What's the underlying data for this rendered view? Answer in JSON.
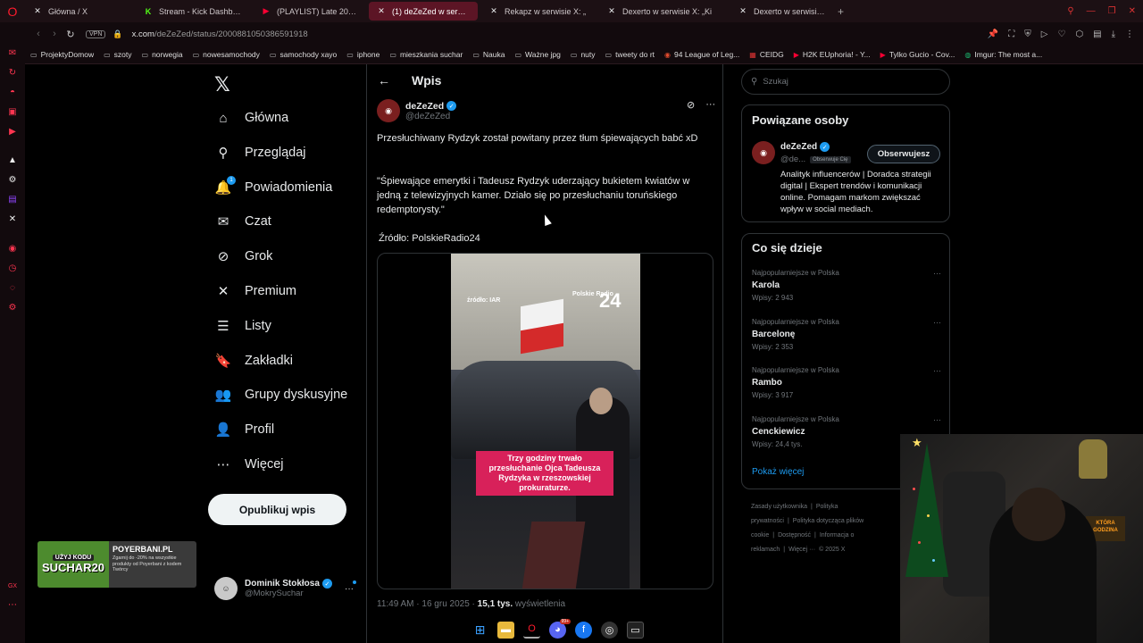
{
  "browser": {
    "tabs": [
      {
        "label": "Główna / X",
        "icon": "x-logo-icon",
        "color": "#e7e9ea",
        "active": false,
        "width": 120
      },
      {
        "label": "Stream - Kick Dashboard",
        "icon": "kick-icon",
        "color": "#53fc18",
        "active": false,
        "width": 128
      },
      {
        "label": "(PLAYLIST) Late 2000's E",
        "icon": "youtube-icon",
        "color": "#ff0033",
        "active": false,
        "width": 125
      },
      {
        "label": "(1) deZeZed w serwisie",
        "icon": "x-logo-icon",
        "color": "#e7e9ea",
        "active": true,
        "width": 122
      },
      {
        "label": "Rekapz w serwisie X: „",
        "icon": "x-logo-icon",
        "color": "#e7e9ea",
        "active": false,
        "width": 128
      },
      {
        "label": "Dexerto w serwisie X: „Ki",
        "icon": "x-logo-icon",
        "color": "#e7e9ea",
        "active": false,
        "width": 143
      },
      {
        "label": "Dexerto w serwisie X: „Va",
        "icon": "x-logo-icon",
        "color": "#e7e9ea",
        "active": false,
        "width": 114
      }
    ],
    "vpn_label": "VPN",
    "url_host": "x.com",
    "url_path": "/deZeZed/status/2000881050386591918",
    "bookmarks": [
      {
        "label": "ProjektyDomow",
        "icon": "folder-icon"
      },
      {
        "label": "szoty",
        "icon": "folder-icon"
      },
      {
        "label": "norwegia",
        "icon": "folder-icon"
      },
      {
        "label": "nowesamochody",
        "icon": "folder-icon"
      },
      {
        "label": "samochody xayo",
        "icon": "folder-icon"
      },
      {
        "label": "iphone",
        "icon": "folder-icon"
      },
      {
        "label": "mieszkania suchar",
        "icon": "folder-icon"
      },
      {
        "label": "Nauka",
        "icon": "folder-icon"
      },
      {
        "label": "Ważne jpg",
        "icon": "folder-icon"
      },
      {
        "label": "nuty",
        "icon": "folder-icon"
      },
      {
        "label": "tweety do rt",
        "icon": "folder-icon"
      },
      {
        "label": "94 League of Leg...",
        "icon": "lol-icon"
      },
      {
        "label": "CEIDG",
        "icon": "ceidg-icon"
      },
      {
        "label": "H2K EUphoria! - Y...",
        "icon": "youtube-icon"
      },
      {
        "label": "Tylko Gucio - Cov...",
        "icon": "youtube-icon"
      },
      {
        "label": "Imgur: The most a...",
        "icon": "imgur-icon"
      }
    ]
  },
  "nav": {
    "items": [
      {
        "label": "Główna",
        "icon": "home-icon",
        "glyph": "⌂"
      },
      {
        "label": "Przeglądaj",
        "icon": "search-icon",
        "glyph": "⚲"
      },
      {
        "label": "Powiadomienia",
        "icon": "bell-icon",
        "glyph": "🔔"
      },
      {
        "label": "Czat",
        "icon": "mail-icon",
        "glyph": "✉"
      },
      {
        "label": "Grok",
        "icon": "grok-icon",
        "glyph": "⊘"
      },
      {
        "label": "Premium",
        "icon": "x-premium-icon",
        "glyph": "✕"
      },
      {
        "label": "Listy",
        "icon": "list-icon",
        "glyph": "☰"
      },
      {
        "label": "Zakładki",
        "icon": "bookmark-icon",
        "glyph": "🔖"
      },
      {
        "label": "Grupy dyskusyjne",
        "icon": "communities-icon",
        "glyph": "👥"
      },
      {
        "label": "Profil",
        "icon": "profile-icon",
        "glyph": "👤"
      },
      {
        "label": "Więcej",
        "icon": "more-circle-icon",
        "glyph": "⋯"
      }
    ],
    "notification_count": "1",
    "post_button": "Opublikuj wpis",
    "account": {
      "name": "Dominik Stokłosa",
      "handle": "@MokrySuchar"
    }
  },
  "ad": {
    "small": "UŻYJ KODU",
    "code": "SUCHAR20",
    "brand": "POYERBANI.PL",
    "text": "Zgarnij do -20% na wszystkie produkty od Poyerbani z kodem Twórcy"
  },
  "post": {
    "header_title": "Wpis",
    "author_name": "deZeZed",
    "author_handle": "@deZeZed",
    "paragraph1": "Przesłuchiwany Rydzyk został powitany przez tłum śpiewających babć xD",
    "paragraph2": "\"Śpiewające emerytki i Tadeusz Rydzyk uderzający bukietem kwiatów w jedną z telewizyjnych kamer. Działo się po przesłuchaniu toruńskiego redemptorysty.\"",
    "source": "Źródło: PolskieRadio24",
    "video": {
      "source_label": "źródło: IAR",
      "logo_text": "Polskie Radio",
      "logo_num": "24",
      "caption": "Trzy godziny trwało przesłuchanie Ojca Tadeusza Rydzyka w rzeszowskiej prokuraturze."
    },
    "time": "11:49 AM · 16 gru 2025 · ",
    "views": "15,1 tys.",
    "views_label": " wyświetlenia"
  },
  "right": {
    "search_placeholder": "Szukaj",
    "related_title": "Powiązane osoby",
    "related": {
      "name": "deZeZed",
      "handle": "@de...",
      "follows_you": "Obserwuje Cię",
      "follow_button": "Obserwujesz",
      "bio": "Analityk influencerów | Doradca strategii digital | Ekspert trendów i komunikacji online. Pomagam markom zwiększać wpływ w social mediach."
    },
    "trending_title": "Co się dzieje",
    "trends": [
      {
        "meta": "Najpopularniejsze w Polska",
        "name": "Karola",
        "count": "Wpisy: 2 943"
      },
      {
        "meta": "Najpopularniejsze w Polska",
        "name": "Barcelonę",
        "count": "Wpisy: 2 353"
      },
      {
        "meta": "Najpopularniejsze w Polska",
        "name": "Rambo",
        "count": "Wpisy: 3 917"
      },
      {
        "meta": "Najpopularniejsze w Polska",
        "name": "Cenckiewicz",
        "count": "Wpisy: 24,4 tys."
      }
    ],
    "show_more": "Pokaż więcej",
    "footer_links": [
      "Zasady użytkownika",
      "|",
      "Polityka prywatności",
      "|",
      "Polityka dotycząca plików cookie",
      "|",
      "Dostępność",
      "|",
      "Informacja o reklamach",
      "|",
      "Więcej ···",
      "© 2025 X"
    ]
  },
  "webcam": {
    "box_text": "KTÓRA GODZINA"
  },
  "taskbar": {
    "discord_badge": "99+"
  }
}
